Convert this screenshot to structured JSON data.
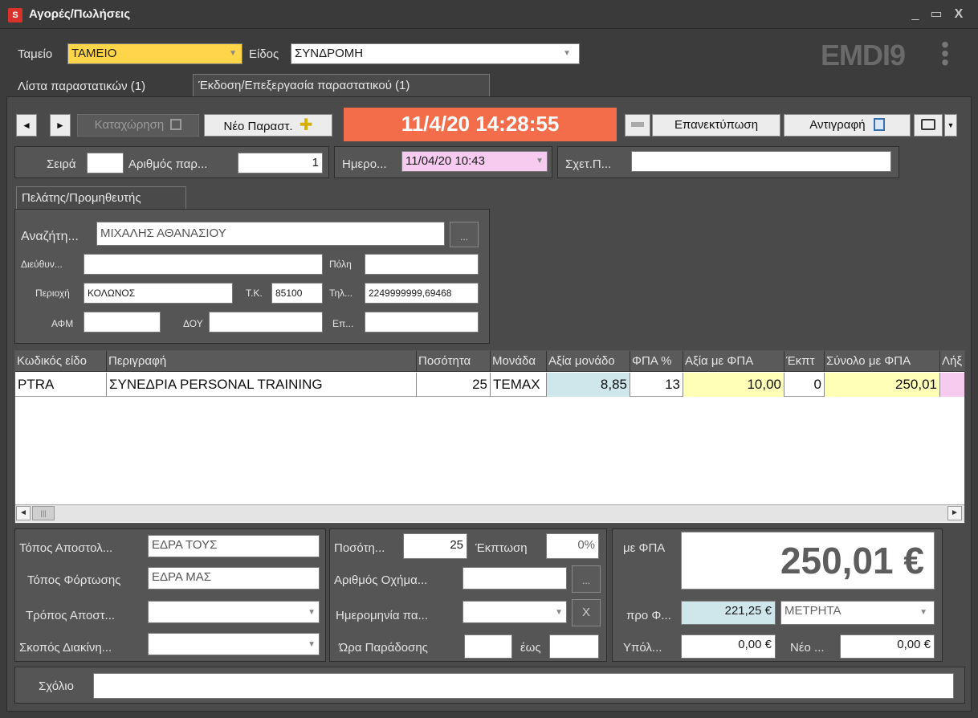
{
  "window": {
    "title": "Αγορές/Πωλήσεις",
    "app_icon": "app-logo-icon",
    "controls": [
      "_",
      "▭",
      "X"
    ],
    "brand": "EMDI9"
  },
  "top": {
    "cashbox_label": "Ταμείο",
    "cashbox_value": "ΤΑΜΕΙΟ",
    "type_label": "Είδος",
    "type_value": "ΣΥΝΔΡΟΜΗ"
  },
  "tabs": [
    {
      "label": "Λίστα παραστατικών (1)"
    },
    {
      "label": "Έκδοση/Επεξεργασία παραστατικού (1)"
    }
  ],
  "toolbar": {
    "prev": "◄",
    "next": "►",
    "save_label": "Καταχώρηση",
    "new_label": "Νέο Παραστ.",
    "clock": "11/4/20 14:28:55",
    "reprint_label": "Επανεκτύπωση",
    "copy_label": "Αντιγραφή"
  },
  "doc": {
    "series_label": "Σειρά",
    "series_value": "",
    "number_label": "Αριθμός παρ...",
    "number_value": "1",
    "date_label": "Ημερο...",
    "date_value": "11/04/20 10:43",
    "rel_label": "Σχετ.Π...",
    "rel_value": ""
  },
  "customer": {
    "tab_label": "Πελάτης/Προμηθευτής",
    "search_label": "Αναζήτη...",
    "search_value": "ΜΙΧΑΛΗΣ ΑΘΑΝΑΣΙΟΥ",
    "address_label": "Διεύθυν...",
    "address_value": "",
    "city_label": "Πόλη",
    "city_value": "",
    "area_label": "Περιοχή",
    "area_value": "ΚΟΛΩΝΟΣ",
    "zip_label": "Τ.Κ.",
    "zip_value": "85100",
    "phone_label": "Τηλ...",
    "phone_value": "2249999999,69468",
    "vat_label": "ΑΦΜ",
    "vat_value": "",
    "taxoffice_label": "ΔΟΥ",
    "taxoffice_value": "",
    "prof_label": "Επ...",
    "prof_value": ""
  },
  "grid": {
    "columns": [
      "Κωδικός είδο",
      "Περιγραφή",
      "Ποσότητα",
      "Μονάδα",
      "Αξία μονάδο",
      "ΦΠΑ %",
      "Αξία με ΦΠΑ",
      "Έκπτ",
      "Σύνολο με ΦΠΑ",
      "Λήξ"
    ],
    "rows": [
      [
        "PTRA",
        "ΣΥΝΕΔΡΙΑ PERSONAL TRAINING",
        "25",
        "ΤΕΜΑΧ",
        "8,85",
        "13",
        "10,00",
        "0",
        "250,01",
        ""
      ]
    ]
  },
  "shipping": {
    "dest_label": "Τόπος Αποστολ...",
    "dest_value": "ΕΔΡΑ ΤΟΥΣ",
    "load_label": "Τόπος Φόρτωσης",
    "load_value": "ΕΔΡΑ ΜΑΣ",
    "method_label": "Τρόπος Αποστ...",
    "method_value": "",
    "purpose_label": "Σκοπός Διακίνη...",
    "purpose_value": ""
  },
  "delivery": {
    "qty_label": "Ποσότη...",
    "qty_value": "25",
    "discount_label": "Έκπτωση",
    "discount_value": "0%",
    "vehicle_label": "Αριθμός Οχήμα...",
    "vehicle_value": "",
    "date_label": "Ημερομηνία πα...",
    "date_value": "",
    "time_label": "Ώρα Παράδοσης",
    "time_from": "",
    "until_label": "έως",
    "time_to": ""
  },
  "totals": {
    "with_vat_label": "με ΦΠΑ",
    "total": "250,01 €",
    "pre_vat_label": "προ Φ...",
    "pre_vat_value": "221,25 €",
    "payment_method": "ΜΕΤΡΗΤΑ",
    "balance_label": "Υπόλ...",
    "balance_value": "0,00 €",
    "new_label": "Νέο ...",
    "new_value": "0,00 €"
  },
  "comment": {
    "label": "Σχόλιο",
    "value": ""
  }
}
